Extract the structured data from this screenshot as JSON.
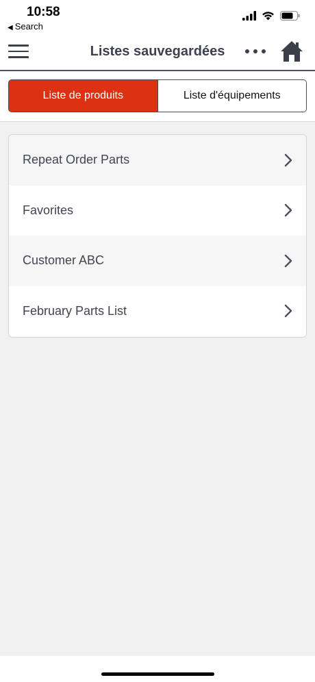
{
  "status": {
    "time": "10:58",
    "back_label": "Search"
  },
  "nav": {
    "title": "Listes sauvegardées"
  },
  "tabs": [
    {
      "label": "Liste de produits",
      "active": true
    },
    {
      "label": "Liste d'équipements",
      "active": false
    }
  ],
  "lists": [
    {
      "label": "Repeat Order Parts"
    },
    {
      "label": "Favorites"
    },
    {
      "label": "Customer ABC"
    },
    {
      "label": "February Parts List"
    }
  ],
  "colors": {
    "accent": "#dc3112",
    "nav_text": "#3d4150"
  },
  "icons": [
    "menu-icon",
    "more-icon",
    "home-icon",
    "chevron-right-icon",
    "signal-icon",
    "wifi-icon",
    "battery-icon"
  ]
}
